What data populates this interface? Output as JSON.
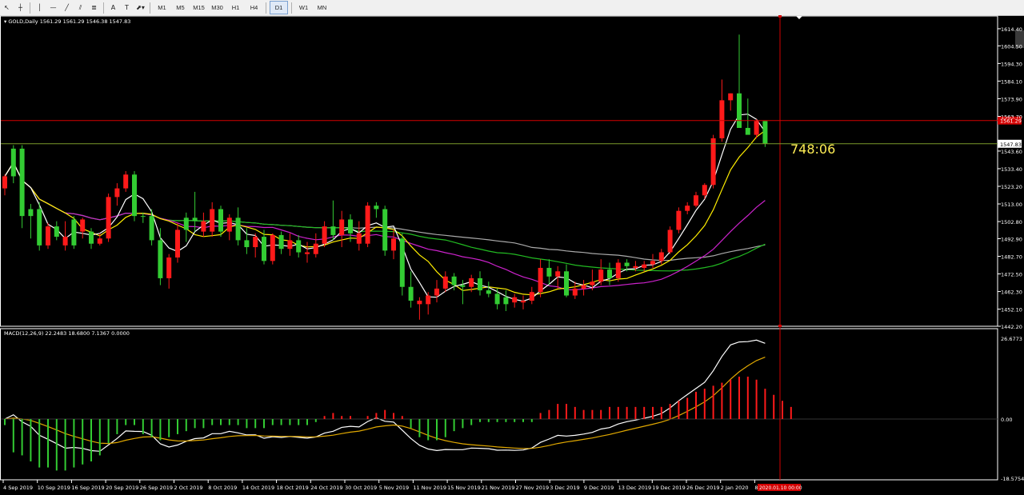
{
  "toolbar": {
    "tools": [
      {
        "name": "cursor-arrow-icon",
        "glyph": "↖"
      },
      {
        "name": "crosshair-icon",
        "glyph": "┼"
      },
      {
        "name": "vertical-line-icon",
        "glyph": "│"
      },
      {
        "name": "horizontal-line-icon",
        "glyph": "—"
      },
      {
        "name": "trendline-icon",
        "glyph": "╱"
      },
      {
        "name": "channel-icon",
        "glyph": "⫽"
      },
      {
        "name": "fibonacci-icon",
        "glyph": "≣"
      },
      {
        "name": "text-tool-icon",
        "glyph": "A"
      },
      {
        "name": "text-label-icon",
        "glyph": "T"
      },
      {
        "name": "shapes-dropdown-icon",
        "glyph": "⬈▾"
      }
    ],
    "timeframes": [
      "M1",
      "M5",
      "M15",
      "M30",
      "H1",
      "H4",
      "D1",
      "W1",
      "MN"
    ],
    "active_timeframe": "D1"
  },
  "chart_header": {
    "symbol": "GOLD,Daily",
    "ohlc": "1561.29 1561.29 1546.38 1547.83"
  },
  "countdown": "748:06",
  "macd_label": "MACD(12,26,9) 22.2483 18.6800 7.1367 0.0000",
  "price_axis": [
    "1614.40",
    "1604.50",
    "1594.30",
    "1584.10",
    "1573.90",
    "1563.70",
    "1543.60",
    "1533.40",
    "1523.20",
    "1513.00",
    "1502.80",
    "1492.90",
    "1482.70",
    "1472.50",
    "1462.30",
    "1452.10",
    "1442.20"
  ],
  "price_tags": {
    "red": "1561.29",
    "bid": "1547.83"
  },
  "macd_axis": [
    "26.6773",
    "0.00",
    "-18.5754"
  ],
  "date_axis": [
    "4 Sep 2019",
    "10 Sep 2019",
    "16 Sep 2019",
    "20 Sep 2019",
    "26 Sep 2019",
    "2 Oct 2019",
    "8 Oct 2019",
    "14 Oct 2019",
    "18 Oct 2019",
    "24 Oct 2019",
    "30 Oct 2019",
    "5 Nov 2019",
    "11 Nov 2019",
    "15 Nov 2019",
    "21 Nov 2019",
    "27 Nov 2019",
    "3 Dec 2019",
    "9 Dec 2019",
    "13 Dec 2019",
    "19 Dec 2019",
    "26 Dec 2019",
    "2 Jan 2020",
    "8"
  ],
  "cursor_date": "2020.01.10 00:00",
  "colors": {
    "bull": "#33cc33",
    "bear": "#ff1a1a",
    "ma_white": "#ffffff",
    "ma_yellow": "#ffee00",
    "ma_magenta": "#cc22cc",
    "ma_green": "#22bb22",
    "ma_grey": "#aaaaaa",
    "hist_neg": "#33cc33",
    "hist_pos": "#ff1a1a",
    "line_red": "#d40000",
    "line_green": "#7a9a2a",
    "countdown": "#ffee55"
  },
  "chart_data": {
    "type": "candlestick",
    "candles": [
      [
        1522,
        1530,
        1518,
        1529
      ],
      [
        1529,
        1547,
        1525,
        1545
      ],
      [
        1545,
        1547,
        1499,
        1506
      ],
      [
        1506,
        1513,
        1493,
        1510
      ],
      [
        1510,
        1514,
        1486,
        1489
      ],
      [
        1489,
        1502,
        1487,
        1500
      ],
      [
        1500,
        1503,
        1492,
        1494
      ],
      [
        1494,
        1503,
        1486,
        1489
      ],
      [
        1489,
        1506,
        1487,
        1504
      ],
      [
        1504,
        1505,
        1493,
        1497
      ],
      [
        1497,
        1499,
        1487,
        1490
      ],
      [
        1490,
        1496,
        1489,
        1493
      ],
      [
        1493,
        1519,
        1491,
        1517
      ],
      [
        1517,
        1525,
        1512,
        1522
      ],
      [
        1522,
        1532,
        1520,
        1530
      ],
      [
        1530,
        1532,
        1503,
        1506
      ],
      [
        1506,
        1508,
        1502,
        1506
      ],
      [
        1506,
        1510,
        1489,
        1492
      ],
      [
        1492,
        1499,
        1466,
        1470
      ],
      [
        1470,
        1484,
        1464,
        1482
      ],
      [
        1482,
        1502,
        1479,
        1498
      ],
      [
        1498,
        1508,
        1491,
        1505
      ],
      [
        1505,
        1520,
        1497,
        1503
      ],
      [
        1503,
        1508,
        1494,
        1497
      ],
      [
        1497,
        1514,
        1494,
        1510
      ],
      [
        1510,
        1512,
        1494,
        1497
      ],
      [
        1497,
        1507,
        1492,
        1505
      ],
      [
        1505,
        1511,
        1489,
        1492
      ],
      [
        1492,
        1499,
        1484,
        1488
      ],
      [
        1488,
        1496,
        1482,
        1494
      ],
      [
        1494,
        1498,
        1478,
        1480
      ],
      [
        1480,
        1496,
        1478,
        1495
      ],
      [
        1495,
        1497,
        1484,
        1487
      ],
      [
        1487,
        1496,
        1483,
        1492
      ],
      [
        1492,
        1495,
        1482,
        1485
      ],
      [
        1485,
        1491,
        1479,
        1484
      ],
      [
        1484,
        1496,
        1482,
        1490
      ],
      [
        1490,
        1503,
        1488,
        1500
      ],
      [
        1500,
        1515,
        1492,
        1495
      ],
      [
        1495,
        1509,
        1488,
        1504
      ],
      [
        1504,
        1507,
        1491,
        1496
      ],
      [
        1496,
        1503,
        1486,
        1490
      ],
      [
        1490,
        1514,
        1488,
        1512
      ],
      [
        1512,
        1514,
        1505,
        1510
      ],
      [
        1510,
        1512,
        1483,
        1486
      ],
      [
        1486,
        1498,
        1481,
        1493
      ],
      [
        1493,
        1496,
        1460,
        1465
      ],
      [
        1465,
        1474,
        1453,
        1457
      ],
      [
        1457,
        1459,
        1446,
        1455
      ],
      [
        1455,
        1462,
        1449,
        1460
      ],
      [
        1460,
        1469,
        1456,
        1464
      ],
      [
        1464,
        1474,
        1462,
        1471
      ],
      [
        1471,
        1473,
        1463,
        1466
      ],
      [
        1466,
        1469,
        1455,
        1465
      ],
      [
        1465,
        1472,
        1462,
        1470
      ],
      [
        1470,
        1474,
        1460,
        1463
      ],
      [
        1463,
        1468,
        1459,
        1461
      ],
      [
        1461,
        1464,
        1452,
        1455
      ],
      [
        1455,
        1463,
        1451,
        1459
      ],
      [
        1459,
        1461,
        1453,
        1456
      ],
      [
        1456,
        1460,
        1452,
        1457
      ],
      [
        1457,
        1465,
        1455,
        1462
      ],
      [
        1462,
        1481,
        1459,
        1476
      ],
      [
        1476,
        1481,
        1466,
        1471
      ],
      [
        1471,
        1477,
        1464,
        1474
      ],
      [
        1474,
        1478,
        1459,
        1460
      ],
      [
        1460,
        1468,
        1458,
        1464
      ],
      [
        1464,
        1469,
        1460,
        1466
      ],
      [
        1466,
        1475,
        1463,
        1468
      ],
      [
        1468,
        1481,
        1466,
        1475
      ],
      [
        1475,
        1479,
        1466,
        1470
      ],
      [
        1470,
        1481,
        1468,
        1479
      ],
      [
        1479,
        1481,
        1474,
        1477
      ],
      [
        1477,
        1480,
        1474,
        1476
      ],
      [
        1476,
        1480,
        1474,
        1478
      ],
      [
        1478,
        1484,
        1476,
        1480
      ],
      [
        1480,
        1487,
        1478,
        1485
      ],
      [
        1485,
        1500,
        1484,
        1498
      ],
      [
        1498,
        1511,
        1496,
        1509
      ],
      [
        1509,
        1514,
        1507,
        1512
      ],
      [
        1512,
        1520,
        1511,
        1518
      ],
      [
        1518,
        1525,
        1516,
        1524
      ],
      [
        1524,
        1553,
        1522,
        1551
      ],
      [
        1551,
        1585,
        1549,
        1573
      ],
      [
        1573,
        1577,
        1567,
        1577
      ],
      [
        1577,
        1611,
        1564,
        1557
      ],
      [
        1557,
        1574,
        1555,
        1553
      ],
      [
        1553,
        1562,
        1551,
        1561
      ],
      [
        1561,
        1561,
        1546,
        1548
      ]
    ],
    "candle_dir": [
      0,
      1,
      1,
      1,
      1,
      0,
      1,
      0,
      1,
      0,
      1,
      0,
      0,
      0,
      0,
      1,
      1,
      1,
      1,
      0,
      0,
      1,
      1,
      0,
      0,
      1,
      0,
      1,
      1,
      0,
      1,
      0,
      1,
      0,
      1,
      0,
      0,
      0,
      1,
      0,
      1,
      0,
      0,
      1,
      1,
      0,
      1,
      1,
      0,
      0,
      0,
      0,
      1,
      1,
      0,
      1,
      1,
      1,
      1,
      0,
      0,
      0,
      0,
      1,
      0,
      1,
      0,
      0,
      0,
      0,
      1,
      0,
      1,
      0,
      0,
      0,
      0,
      0,
      0,
      0,
      0,
      0,
      0,
      0,
      0,
      1,
      1,
      0,
      1
    ],
    "macd_hist": [
      -2,
      -11,
      -12,
      -14,
      -16,
      -16,
      -17,
      -17,
      -16,
      -15,
      -14,
      -12,
      -8,
      -5,
      -2,
      -2,
      -5,
      -6,
      -7,
      -6,
      -5,
      -4,
      -3,
      -3,
      -2,
      -2,
      -2,
      -2,
      -3,
      -3,
      -3,
      -2,
      -2,
      -2,
      -2,
      -2,
      -1,
      1,
      2,
      1,
      1,
      0,
      1,
      2,
      3,
      2,
      1,
      -3,
      -6,
      -7,
      -7,
      -6,
      -4,
      -3,
      -2,
      -1,
      -1,
      -1,
      -1,
      -1,
      -1,
      -1,
      2,
      3,
      5,
      5,
      4,
      3,
      3,
      3,
      4,
      4,
      4,
      4,
      4,
      4,
      4,
      5,
      6,
      7,
      9,
      10,
      11,
      12,
      13,
      14,
      14,
      13,
      10,
      8,
      6,
      4
    ]
  }
}
